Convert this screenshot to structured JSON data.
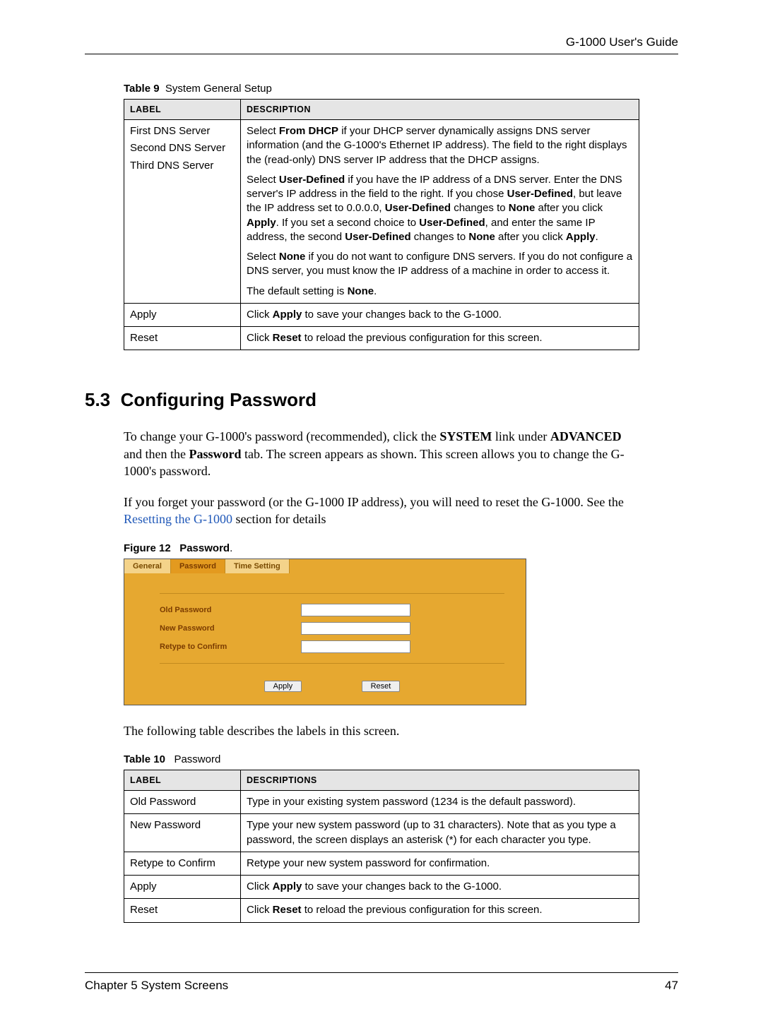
{
  "header": {
    "title": "G-1000 User's Guide"
  },
  "table9": {
    "caption_prefix": "Table 9",
    "caption_title": "System General Setup",
    "col_label": "LABEL",
    "col_desc": "DESCRIPTION",
    "row1": {
      "label_line1": "First DNS Server",
      "label_line2": "Second DNS Server",
      "label_line3": "Third DNS Server",
      "p1_a": "Select ",
      "p1_b": "From DHCP",
      "p1_c": " if your DHCP server dynamically assigns DNS server information (and the G-1000's Ethernet IP address). The field to the right displays the (read-only) DNS server IP address that the DHCP assigns.",
      "p2_a": "Select ",
      "p2_b": "User-Defined",
      "p2_c": " if you have the IP address of a DNS server. Enter the DNS server's IP address in the field to the right. If you chose ",
      "p2_d": "User-Defined",
      "p2_e": ", but leave the IP address set to 0.0.0.0, ",
      "p2_f": "User-Defined",
      "p2_g": " changes to ",
      "p2_h": "None",
      "p2_i": " after you click ",
      "p2_j": "Apply",
      "p2_k": ". If you set a second choice to ",
      "p2_l": "User-Defined",
      "p2_m": ", and enter the same IP address, the second ",
      "p2_n": "User-Defined",
      "p2_o": " changes to ",
      "p2_p": "None",
      "p2_q": " after you click ",
      "p2_r": "Apply",
      "p2_s": ".",
      "p3_a": "Select ",
      "p3_b": "None",
      "p3_c": " if you do not want to configure DNS servers. If you do not configure a DNS server, you must know the IP address of a machine in order to access it.",
      "p4_a": "The default setting is ",
      "p4_b": "None",
      "p4_c": "."
    },
    "row2": {
      "label": "Apply",
      "d_a": "Click ",
      "d_b": "Apply",
      "d_c": " to save your changes back to the G-1000."
    },
    "row3": {
      "label": "Reset",
      "d_a": "Click ",
      "d_b": "Reset",
      "d_c": " to reload the previous configuration for this screen."
    }
  },
  "section": {
    "number": "5.3",
    "title": "Configuring Password"
  },
  "para1": {
    "a": "To change your G-1000's password (recommended), click the ",
    "b": "SYSTEM",
    "c": " link under ",
    "d": "ADVANCED",
    "e": " and then the ",
    "f": "Password",
    "g": " tab. The screen appears as shown. This screen allows you to change the G-1000's password."
  },
  "para2": {
    "a": "If you forget your password (or the G-1000 IP address), you will need to reset the G-1000. See the ",
    "link": "Resetting the G-1000",
    "b": " section for details"
  },
  "figure": {
    "caption_prefix": "Figure 12",
    "caption_title": "Password",
    "caption_dot": ".",
    "tab_general": "General",
    "tab_password": "Password",
    "tab_time": "Time Setting",
    "label_old": "Old Password",
    "label_new": "New Password",
    "label_confirm": "Retype to Confirm",
    "btn_apply": "Apply",
    "btn_reset": "Reset"
  },
  "para3": "The following table describes the labels in this screen.",
  "table10": {
    "caption_prefix": "Table 10",
    "caption_title": "Password",
    "col_label": "LABEL",
    "col_desc": "DESCRIPTIONS",
    "r1_label": "Old Password",
    "r1_desc": "Type in your existing system password (1234 is the default password).",
    "r2_label": "New Password",
    "r2_desc": "Type your new system password (up to 31 characters). Note that as you type a password, the screen displays an asterisk (*) for each character you type.",
    "r3_label": "Retype to Confirm",
    "r3_desc": "Retype your new system password for confirmation.",
    "r4_label": "Apply",
    "r4_a": "Click ",
    "r4_b": "Apply",
    "r4_c": " to save your changes back to the G-1000.",
    "r5_label": "Reset",
    "r5_a": "Click ",
    "r5_b": "Reset",
    "r5_c": " to reload the previous configuration for this screen."
  },
  "footer": {
    "chapter": "Chapter 5 System Screens",
    "page": "47"
  }
}
